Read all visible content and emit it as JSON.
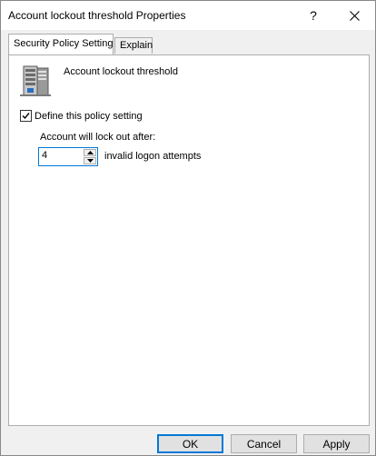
{
  "window": {
    "title": "Account lockout threshold Properties",
    "help_glyph": "?",
    "close_icon": "close-icon"
  },
  "tabs": [
    {
      "label": "Security Policy Setting",
      "active": true
    },
    {
      "label": "Explain",
      "active": false
    }
  ],
  "policy": {
    "icon": "server-policy-icon",
    "name": "Account lockout threshold",
    "define_label": "Define this policy setting",
    "define_checked": true,
    "lockout_label": "Account will lock out after:",
    "threshold_value": "4",
    "unit_label": "invalid logon attempts"
  },
  "buttons": {
    "ok": "OK",
    "cancel": "Cancel",
    "apply": "Apply"
  },
  "colors": {
    "accent": "#0078d7",
    "window_bg": "#f0f0f0",
    "panel_bg": "#ffffff",
    "button_bg": "#e1e1e1"
  }
}
